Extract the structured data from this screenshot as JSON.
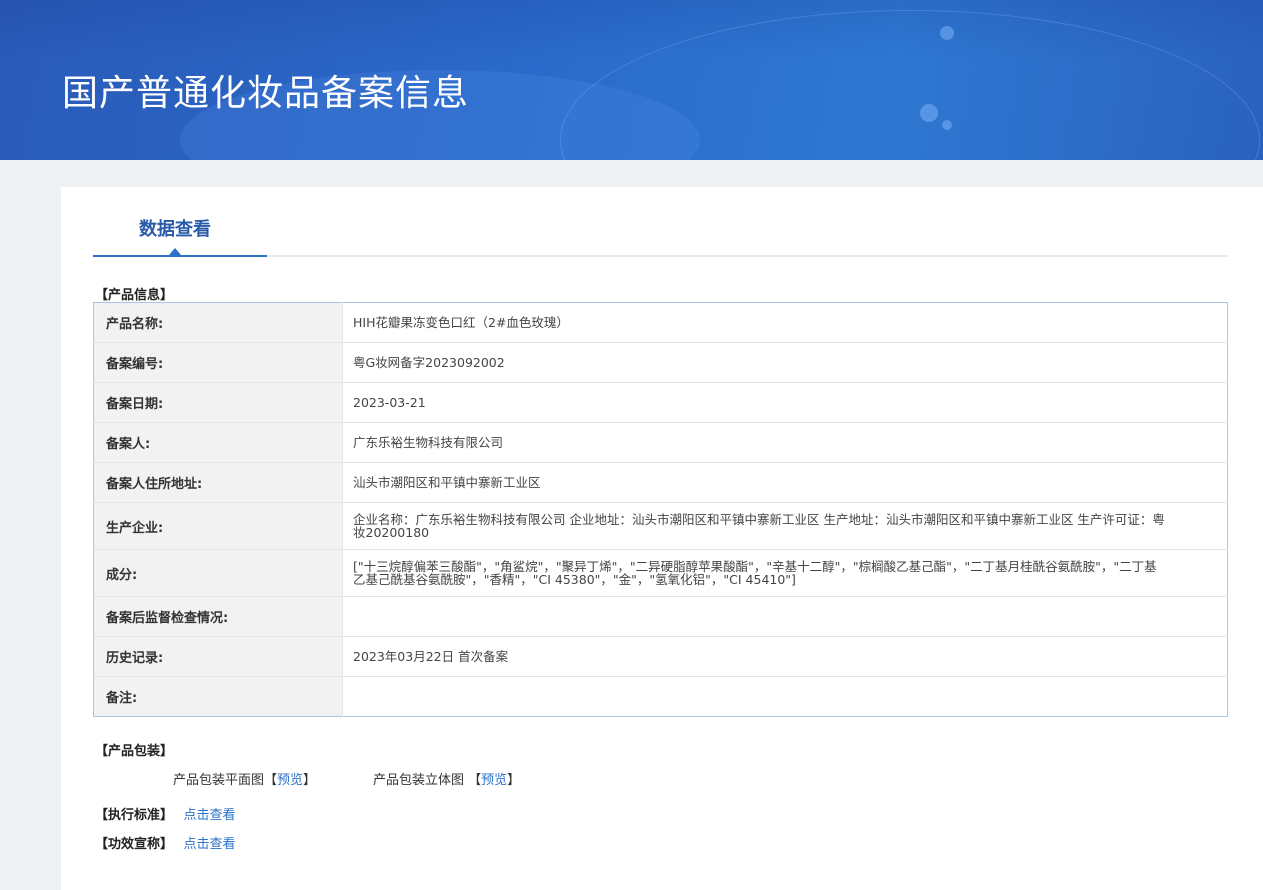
{
  "banner": {
    "title": "国产普通化妆品备案信息"
  },
  "tab": {
    "label": "数据查看"
  },
  "product_info": {
    "section_title": "【产品信息】",
    "rows": [
      {
        "label": "产品名称:",
        "value": "HIH花瓣果冻变色口红（2#血色玫瑰）"
      },
      {
        "label": "备案编号:",
        "value": "粤G妆网备字2023092002"
      },
      {
        "label": "备案日期:",
        "value": "2023-03-21"
      },
      {
        "label": "备案人:",
        "value": "广东乐裕生物科技有限公司"
      },
      {
        "label": "备案人住所地址:",
        "value": "汕头市潮阳区和平镇中寨新工业区"
      },
      {
        "label": "生产企业:",
        "value": "企业名称：广东乐裕生物科技有限公司 企业地址：汕头市潮阳区和平镇中寨新工业区 生产地址：汕头市潮阳区和平镇中寨新工业区 生产许可证：粤妆20200180"
      },
      {
        "label": "成分:",
        "value": "[\"十三烷醇偏苯三酸酯\"，\"角鲨烷\"，\"聚异丁烯\"，\"二异硬脂醇苹果酸酯\"，\"辛基十二醇\"，\"棕榈酸乙基己酯\"，\"二丁基月桂酰谷氨酰胺\"，\"二丁基乙基己酰基谷氨酰胺\"，\"香精\"，\"CI 45380\"，\"金\"，\"氢氧化铝\"，\"CI 45410\"]"
      },
      {
        "label": "备案后监督检查情况:",
        "value": ""
      },
      {
        "label": "历史记录:",
        "value": "2023年03月22日 首次备案"
      },
      {
        "label": "备注:",
        "value": ""
      }
    ]
  },
  "packaging": {
    "section_title": "【产品包装】",
    "flat_label": "产品包装平面图",
    "flat_link": "预览",
    "solid_label": "产品包装立体图",
    "solid_link": "预览"
  },
  "standard": {
    "section_title": "【执行标准】",
    "link": "点击查看"
  },
  "efficacy": {
    "section_title": "【功效宣称】",
    "link": "点击查看"
  }
}
